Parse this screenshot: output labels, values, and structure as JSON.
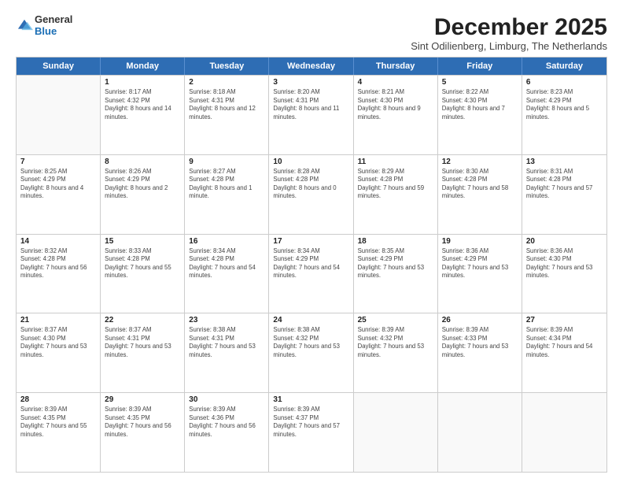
{
  "logo": {
    "general": "General",
    "blue": "Blue"
  },
  "header": {
    "month": "December 2025",
    "location": "Sint Odilienberg, Limburg, The Netherlands"
  },
  "days": [
    "Sunday",
    "Monday",
    "Tuesday",
    "Wednesday",
    "Thursday",
    "Friday",
    "Saturday"
  ],
  "weeks": [
    [
      {
        "date": "",
        "sunrise": "",
        "sunset": "",
        "daylight": ""
      },
      {
        "date": "1",
        "sunrise": "Sunrise: 8:17 AM",
        "sunset": "Sunset: 4:32 PM",
        "daylight": "Daylight: 8 hours and 14 minutes."
      },
      {
        "date": "2",
        "sunrise": "Sunrise: 8:18 AM",
        "sunset": "Sunset: 4:31 PM",
        "daylight": "Daylight: 8 hours and 12 minutes."
      },
      {
        "date": "3",
        "sunrise": "Sunrise: 8:20 AM",
        "sunset": "Sunset: 4:31 PM",
        "daylight": "Daylight: 8 hours and 11 minutes."
      },
      {
        "date": "4",
        "sunrise": "Sunrise: 8:21 AM",
        "sunset": "Sunset: 4:30 PM",
        "daylight": "Daylight: 8 hours and 9 minutes."
      },
      {
        "date": "5",
        "sunrise": "Sunrise: 8:22 AM",
        "sunset": "Sunset: 4:30 PM",
        "daylight": "Daylight: 8 hours and 7 minutes."
      },
      {
        "date": "6",
        "sunrise": "Sunrise: 8:23 AM",
        "sunset": "Sunset: 4:29 PM",
        "daylight": "Daylight: 8 hours and 5 minutes."
      }
    ],
    [
      {
        "date": "7",
        "sunrise": "Sunrise: 8:25 AM",
        "sunset": "Sunset: 4:29 PM",
        "daylight": "Daylight: 8 hours and 4 minutes."
      },
      {
        "date": "8",
        "sunrise": "Sunrise: 8:26 AM",
        "sunset": "Sunset: 4:29 PM",
        "daylight": "Daylight: 8 hours and 2 minutes."
      },
      {
        "date": "9",
        "sunrise": "Sunrise: 8:27 AM",
        "sunset": "Sunset: 4:28 PM",
        "daylight": "Daylight: 8 hours and 1 minute."
      },
      {
        "date": "10",
        "sunrise": "Sunrise: 8:28 AM",
        "sunset": "Sunset: 4:28 PM",
        "daylight": "Daylight: 8 hours and 0 minutes."
      },
      {
        "date": "11",
        "sunrise": "Sunrise: 8:29 AM",
        "sunset": "Sunset: 4:28 PM",
        "daylight": "Daylight: 7 hours and 59 minutes."
      },
      {
        "date": "12",
        "sunrise": "Sunrise: 8:30 AM",
        "sunset": "Sunset: 4:28 PM",
        "daylight": "Daylight: 7 hours and 58 minutes."
      },
      {
        "date": "13",
        "sunrise": "Sunrise: 8:31 AM",
        "sunset": "Sunset: 4:28 PM",
        "daylight": "Daylight: 7 hours and 57 minutes."
      }
    ],
    [
      {
        "date": "14",
        "sunrise": "Sunrise: 8:32 AM",
        "sunset": "Sunset: 4:28 PM",
        "daylight": "Daylight: 7 hours and 56 minutes."
      },
      {
        "date": "15",
        "sunrise": "Sunrise: 8:33 AM",
        "sunset": "Sunset: 4:28 PM",
        "daylight": "Daylight: 7 hours and 55 minutes."
      },
      {
        "date": "16",
        "sunrise": "Sunrise: 8:34 AM",
        "sunset": "Sunset: 4:28 PM",
        "daylight": "Daylight: 7 hours and 54 minutes."
      },
      {
        "date": "17",
        "sunrise": "Sunrise: 8:34 AM",
        "sunset": "Sunset: 4:29 PM",
        "daylight": "Daylight: 7 hours and 54 minutes."
      },
      {
        "date": "18",
        "sunrise": "Sunrise: 8:35 AM",
        "sunset": "Sunset: 4:29 PM",
        "daylight": "Daylight: 7 hours and 53 minutes."
      },
      {
        "date": "19",
        "sunrise": "Sunrise: 8:36 AM",
        "sunset": "Sunset: 4:29 PM",
        "daylight": "Daylight: 7 hours and 53 minutes."
      },
      {
        "date": "20",
        "sunrise": "Sunrise: 8:36 AM",
        "sunset": "Sunset: 4:30 PM",
        "daylight": "Daylight: 7 hours and 53 minutes."
      }
    ],
    [
      {
        "date": "21",
        "sunrise": "Sunrise: 8:37 AM",
        "sunset": "Sunset: 4:30 PM",
        "daylight": "Daylight: 7 hours and 53 minutes."
      },
      {
        "date": "22",
        "sunrise": "Sunrise: 8:37 AM",
        "sunset": "Sunset: 4:31 PM",
        "daylight": "Daylight: 7 hours and 53 minutes."
      },
      {
        "date": "23",
        "sunrise": "Sunrise: 8:38 AM",
        "sunset": "Sunset: 4:31 PM",
        "daylight": "Daylight: 7 hours and 53 minutes."
      },
      {
        "date": "24",
        "sunrise": "Sunrise: 8:38 AM",
        "sunset": "Sunset: 4:32 PM",
        "daylight": "Daylight: 7 hours and 53 minutes."
      },
      {
        "date": "25",
        "sunrise": "Sunrise: 8:39 AM",
        "sunset": "Sunset: 4:32 PM",
        "daylight": "Daylight: 7 hours and 53 minutes."
      },
      {
        "date": "26",
        "sunrise": "Sunrise: 8:39 AM",
        "sunset": "Sunset: 4:33 PM",
        "daylight": "Daylight: 7 hours and 53 minutes."
      },
      {
        "date": "27",
        "sunrise": "Sunrise: 8:39 AM",
        "sunset": "Sunset: 4:34 PM",
        "daylight": "Daylight: 7 hours and 54 minutes."
      }
    ],
    [
      {
        "date": "28",
        "sunrise": "Sunrise: 8:39 AM",
        "sunset": "Sunset: 4:35 PM",
        "daylight": "Daylight: 7 hours and 55 minutes."
      },
      {
        "date": "29",
        "sunrise": "Sunrise: 8:39 AM",
        "sunset": "Sunset: 4:35 PM",
        "daylight": "Daylight: 7 hours and 56 minutes."
      },
      {
        "date": "30",
        "sunrise": "Sunrise: 8:39 AM",
        "sunset": "Sunset: 4:36 PM",
        "daylight": "Daylight: 7 hours and 56 minutes."
      },
      {
        "date": "31",
        "sunrise": "Sunrise: 8:39 AM",
        "sunset": "Sunset: 4:37 PM",
        "daylight": "Daylight: 7 hours and 57 minutes."
      },
      {
        "date": "",
        "sunrise": "",
        "sunset": "",
        "daylight": ""
      },
      {
        "date": "",
        "sunrise": "",
        "sunset": "",
        "daylight": ""
      },
      {
        "date": "",
        "sunrise": "",
        "sunset": "",
        "daylight": ""
      }
    ]
  ]
}
